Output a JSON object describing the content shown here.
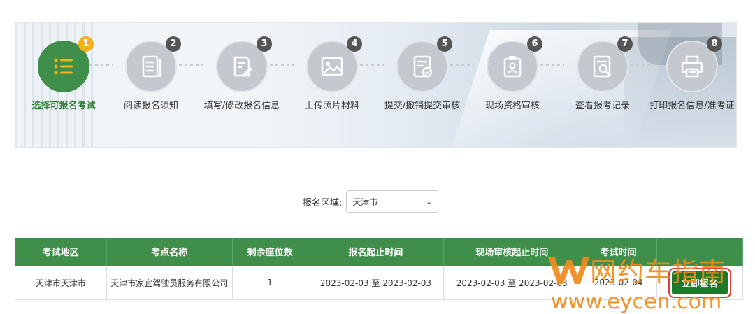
{
  "steps": [
    {
      "num": "1",
      "label": "选择可报名考试",
      "icon": "list-icon",
      "active": true
    },
    {
      "num": "2",
      "label": "阅读报名须知",
      "icon": "document-icon"
    },
    {
      "num": "3",
      "label": "填写/修改报名信息",
      "icon": "edit-document-icon"
    },
    {
      "num": "4",
      "label": "上传照片材料",
      "icon": "image-icon"
    },
    {
      "num": "5",
      "label": "提交/撤销提交审核",
      "icon": "check-document-icon"
    },
    {
      "num": "6",
      "label": "现场资格审核",
      "icon": "badge-clipboard-icon"
    },
    {
      "num": "7",
      "label": "查看报考记录",
      "icon": "search-document-icon"
    },
    {
      "num": "8",
      "label": "打印报名信息/准考证",
      "icon": "printer-icon"
    }
  ],
  "region": {
    "label": "报名区域:",
    "selected": "天津市"
  },
  "table": {
    "headers": [
      "考试地区",
      "考点名称",
      "剩余座位数",
      "报名起止时间",
      "现场审核起止时间",
      "考试时间",
      ""
    ],
    "rows": [
      {
        "area": "天津市天津市",
        "site": "天津市家宜驾驶员服务有限公司",
        "seats": "1",
        "signup": "2023-02-03 至 2023-02-03",
        "review": "2023-02-03 至 2023-02-03",
        "exam_date": "2023-02-04",
        "action": "立即报名"
      }
    ]
  },
  "watermark": {
    "brand": "网约车指南",
    "url": "www.eycen.com"
  },
  "colors": {
    "primary": "#3f8f4a",
    "badge_active": "#f3b21c",
    "watermark": "#f08a1c",
    "highlight": "#e53935"
  }
}
